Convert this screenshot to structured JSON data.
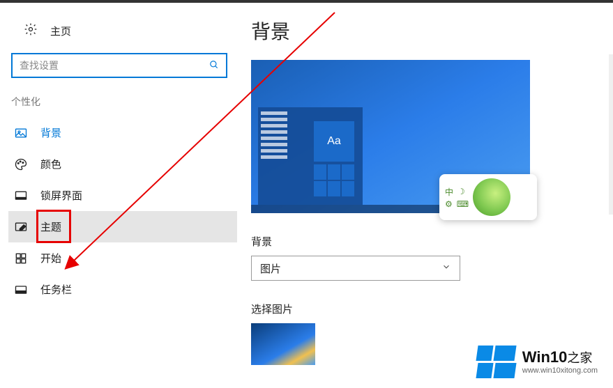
{
  "sidebar": {
    "home_label": "主页",
    "search_placeholder": "查找设置",
    "section_label": "个性化",
    "items": [
      {
        "label": "背景",
        "icon": "picture-icon",
        "active": true
      },
      {
        "label": "颜色",
        "icon": "palette-icon"
      },
      {
        "label": "锁屏界面",
        "icon": "lockscreen-icon"
      },
      {
        "label": "主题",
        "icon": "theme-icon",
        "selected": true,
        "highlighted": true
      },
      {
        "label": "开始",
        "icon": "start-icon"
      },
      {
        "label": "任务栏",
        "icon": "taskbar-icon"
      }
    ]
  },
  "main": {
    "title": "背景",
    "preview_tile_text": "Aa",
    "ime_lang": "中",
    "bg_field_label": "背景",
    "bg_dropdown_value": "图片",
    "choose_image_label": "选择图片"
  },
  "footer": {
    "brand_main": "Win10",
    "brand_sub": "之家",
    "url": "www.win10xitong.com"
  }
}
